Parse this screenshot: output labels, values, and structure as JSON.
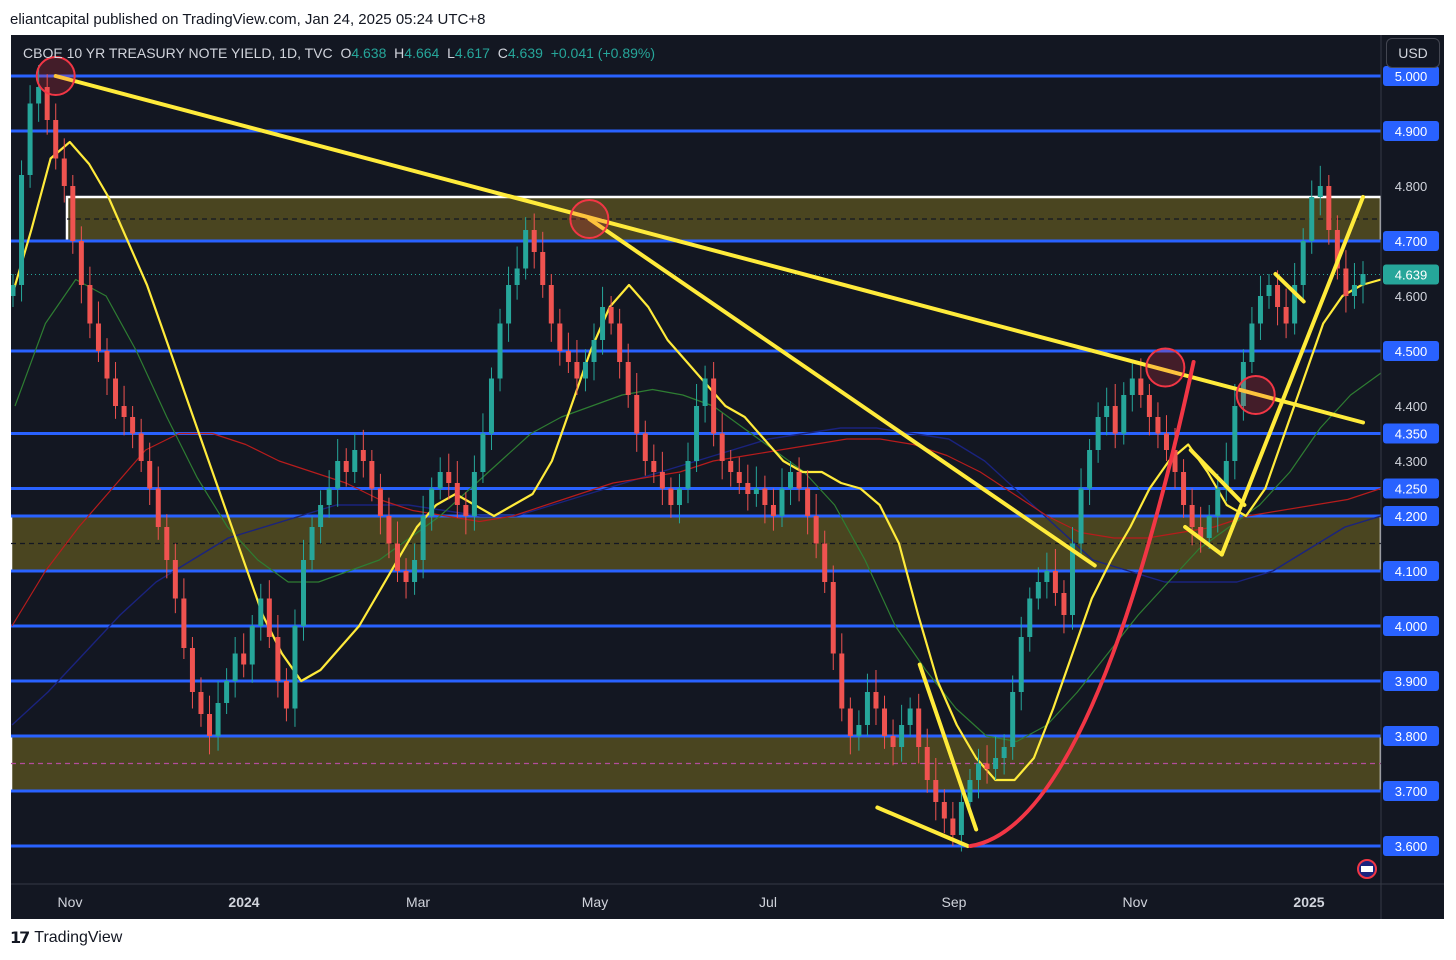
{
  "header_text": "eliantcapital published on TradingView.com, Jan 24, 2025 05:24 UTC+8",
  "symbol": {
    "name": "CBOE 10 YR TREASURY NOTE YIELD, 1D, TVC",
    "open_label": "O",
    "open": "4.638",
    "high_label": "H",
    "high": "4.664",
    "low_label": "L",
    "low": "4.617",
    "close_label": "C",
    "close": "4.639",
    "change": "+0.041 (+0.89%)"
  },
  "currency_button": "USD",
  "footer_brand": "TradingView",
  "chart_data": {
    "type": "line",
    "title": "CBOE 10 YR TREASURY NOTE YIELD",
    "timeframe": "1D",
    "ylim": [
      3.53,
      5.06
    ],
    "y_ticks": [
      "5.000",
      "4.900",
      "4.800",
      "4.700",
      "4.600",
      "4.500",
      "4.400",
      "4.350",
      "4.300",
      "4.250",
      "4.200",
      "4.100",
      "4.000",
      "3.900",
      "3.800",
      "3.700",
      "3.600"
    ],
    "x_ticks": [
      "Nov",
      "2024",
      "Mar",
      "May",
      "Jul",
      "Sep",
      "Nov",
      "2025"
    ],
    "current_price_label": "4.639",
    "highlighted_levels": [
      5.0,
      4.9,
      4.7,
      4.5,
      4.35,
      4.25,
      4.2,
      4.1,
      4.0,
      3.9,
      3.8,
      3.7,
      3.6
    ],
    "zones": [
      {
        "low": 4.7,
        "high": 4.78,
        "mid": 4.74
      },
      {
        "low": 4.1,
        "high": 4.2,
        "mid": 4.15
      },
      {
        "low": 3.7,
        "high": 3.8,
        "mid": 3.75
      }
    ],
    "series": [
      {
        "values": [
          4.62,
          4.82,
          4.95,
          4.98,
          4.92,
          4.85,
          4.8,
          4.7,
          4.62,
          4.55,
          4.5,
          4.45,
          4.4,
          4.38,
          4.35,
          4.3,
          4.25,
          4.18,
          4.12,
          4.05,
          3.96,
          3.88,
          3.84,
          3.8,
          3.86,
          3.9,
          3.95,
          3.93,
          4.0,
          4.05,
          3.98,
          3.9,
          3.85,
          4.0,
          4.12,
          4.18,
          4.22,
          4.25,
          4.3,
          4.28,
          4.32,
          4.3,
          4.25,
          4.2,
          4.15,
          4.1,
          4.08,
          4.12,
          4.2,
          4.25,
          4.28,
          4.26,
          4.22,
          4.2,
          4.28,
          4.35,
          4.45,
          4.55,
          4.62,
          4.65,
          4.72,
          4.68,
          4.62,
          4.55,
          4.5,
          4.48,
          4.45,
          4.48,
          4.52,
          4.58,
          4.55,
          4.48,
          4.42,
          4.35,
          4.3,
          4.28,
          4.25,
          4.22,
          4.25,
          4.3,
          4.4,
          4.45,
          4.35,
          4.3,
          4.28,
          4.26,
          4.24,
          4.25,
          4.22,
          4.2,
          4.25,
          4.28,
          4.25,
          4.2,
          4.15,
          4.08,
          3.95,
          3.85,
          3.8,
          3.82,
          3.88,
          3.85,
          3.8,
          3.78,
          3.82,
          3.85,
          3.78,
          3.72,
          3.68,
          3.65,
          3.62,
          3.68,
          3.72,
          3.75,
          3.74,
          3.76,
          3.78,
          3.88,
          3.98,
          4.05,
          4.08,
          4.1,
          4.06,
          4.02,
          4.15,
          4.25,
          4.32,
          4.38,
          4.4,
          4.35,
          4.42,
          4.45,
          4.42,
          4.38,
          4.35,
          4.32,
          4.28,
          4.22,
          4.18,
          4.16,
          4.2,
          4.25,
          4.3,
          4.4,
          4.48,
          4.55,
          4.6,
          4.62,
          4.58,
          4.55,
          4.62,
          4.7,
          4.78,
          4.8,
          4.72,
          4.65,
          4.6,
          4.62,
          4.64
        ]
      },
      {
        "values": [
          4.6,
          4.72,
          4.85,
          4.88,
          4.84,
          4.78,
          4.7,
          4.62,
          4.52,
          4.42,
          4.32,
          4.22,
          4.12,
          4.02,
          3.95,
          3.9,
          3.92,
          3.96,
          4.0,
          4.06,
          4.12,
          4.18,
          4.22,
          4.24,
          4.22,
          4.2,
          4.22,
          4.24,
          4.3,
          4.4,
          4.5,
          4.58,
          4.62,
          4.58,
          4.52,
          4.48,
          4.44,
          4.4,
          4.38,
          4.34,
          4.3,
          4.28,
          4.28,
          4.26,
          4.25,
          4.22,
          4.15,
          4.02,
          3.9,
          3.82,
          3.76,
          3.72,
          3.72,
          3.76,
          3.85,
          3.95,
          4.05,
          4.12,
          4.18,
          4.25,
          4.3,
          4.33,
          4.28,
          4.22,
          4.2,
          4.25,
          4.35,
          4.45,
          4.55,
          4.6,
          4.62,
          4.63
        ]
      },
      {
        "values": [
          4.4,
          4.55,
          4.63,
          4.6,
          4.5,
          4.38,
          4.27,
          4.18,
          4.12,
          4.08,
          4.08,
          4.1,
          4.12,
          4.16,
          4.2,
          4.25,
          4.3,
          4.35,
          4.38,
          4.4,
          4.42,
          4.43,
          4.42,
          4.4,
          4.36,
          4.32,
          4.28,
          4.22,
          4.12,
          4.0,
          3.92,
          3.85,
          3.8,
          3.79,
          3.82,
          3.88,
          3.95,
          4.02,
          4.08,
          4.14,
          4.18,
          4.22,
          4.28,
          4.36,
          4.42,
          4.46
        ]
      },
      {
        "values": [
          4.0,
          4.1,
          4.18,
          4.25,
          4.32,
          4.35,
          4.35,
          4.33,
          4.3,
          4.28,
          4.26,
          4.23,
          4.21,
          4.2,
          4.19,
          4.2,
          4.22,
          4.24,
          4.26,
          4.27,
          4.28,
          4.3,
          4.31,
          4.32,
          4.33,
          4.34,
          4.34,
          4.33,
          4.31,
          4.28,
          4.24,
          4.2,
          4.17,
          4.16,
          4.16,
          4.17,
          4.18,
          4.2,
          4.21,
          4.22,
          4.23,
          4.25
        ]
      },
      {
        "values": [
          3.82,
          3.88,
          3.95,
          4.02,
          4.08,
          4.12,
          4.16,
          4.18,
          4.2,
          4.22,
          4.22,
          4.22,
          4.21,
          4.2,
          4.2,
          4.22,
          4.24,
          4.26,
          4.28,
          4.3,
          4.32,
          4.34,
          4.35,
          4.36,
          4.36,
          4.35,
          4.34,
          4.3,
          4.24,
          4.18,
          4.12,
          4.1,
          4.08,
          4.08,
          4.08,
          4.1,
          4.14,
          4.18,
          4.2
        ]
      }
    ],
    "trendlines": [
      {
        "from": [
          "Oct 19 2023",
          5.0
        ],
        "to": [
          "Jan 24 2025",
          4.37
        ]
      },
      {
        "from": [
          "Apr 25 2024",
          4.74
        ],
        "to": [
          "Oct 21 2024",
          4.11
        ]
      },
      {
        "from": [
          "Aug 05 2024",
          3.67
        ],
        "to": [
          "Sep 06 2024",
          3.6
        ]
      },
      {
        "from": [
          "Aug 20 2024",
          3.93
        ],
        "to": [
          "Sep 09 2024",
          3.63
        ]
      },
      {
        "from": [
          "Nov 24 2024",
          4.32
        ],
        "to": [
          "Dec 13 2024",
          4.22
        ]
      },
      {
        "from": [
          "Nov 22 2024",
          4.18
        ],
        "to": [
          "Dec 05 2024",
          4.13
        ]
      },
      {
        "from": [
          "Dec 05 2024",
          4.13
        ],
        "to": [
          "Jan 24 2025",
          4.78
        ]
      },
      {
        "from": [
          "Dec 24 2024",
          4.64
        ],
        "to": [
          "Jan 03 2025",
          4.59
        ]
      }
    ],
    "curved_trend": {
      "from": [
        "Sep 07 2024",
        3.6
      ],
      "to": [
        "Nov 25 2024",
        4.48
      ]
    },
    "circles": [
      [
        "Oct 19 2023",
        5.0
      ],
      [
        "Apr 25 2024",
        4.74
      ],
      [
        "Nov 15 2024",
        4.47
      ],
      [
        "Dec 17 2024",
        4.42
      ]
    ],
    "grid": false,
    "colors": {
      "background": "#131722",
      "level_line": "#2962ff",
      "zone_fill": "#4a4520",
      "zone_border": "#ffffff",
      "trendline": "#ffeb3b",
      "curve": "#f23645",
      "circle": "#f23645",
      "up_candle": "#26a69a",
      "down_candle": "#ef5350",
      "ma_short": "#ffeb3b",
      "ma_mid": "#2e7d32",
      "ma_long_1": "#b71c1c",
      "ma_long_2": "#1a237e",
      "price_label_bg": "#2962ff",
      "current_label_bg": "#26a69a"
    }
  }
}
